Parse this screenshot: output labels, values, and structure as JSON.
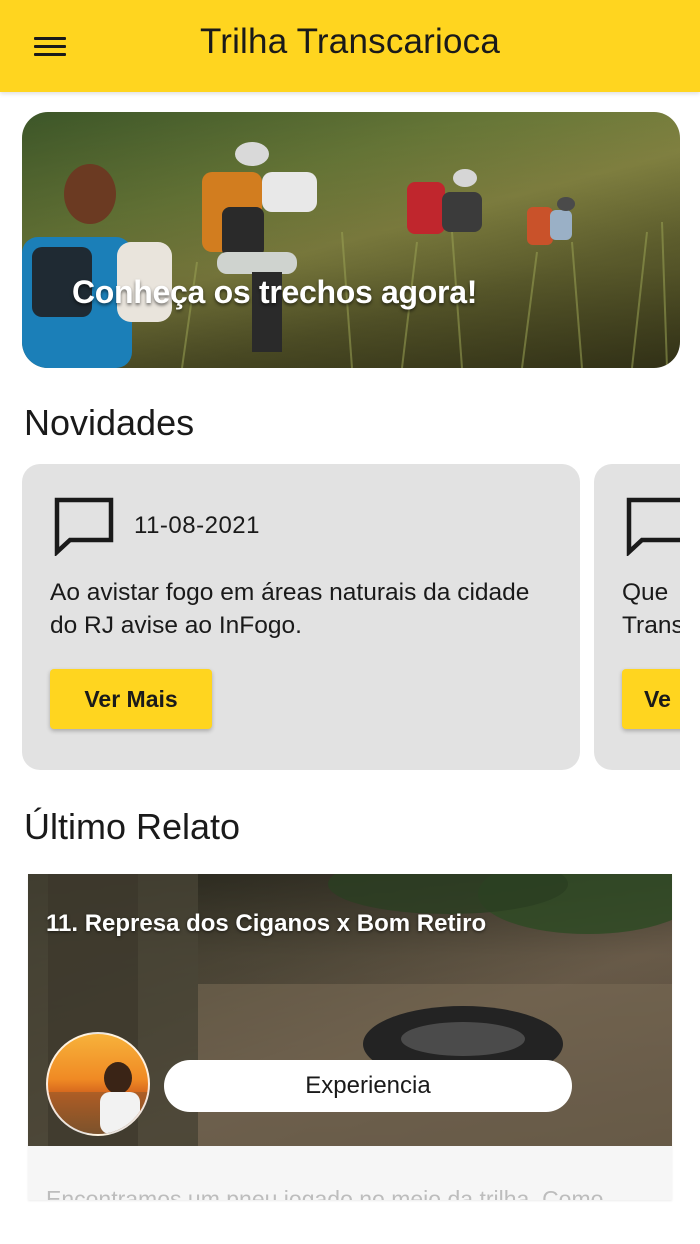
{
  "appbar": {
    "title": "Trilha Transcarioca",
    "menu_icon": "hamburger-menu-icon",
    "background_color": "#FFD51F"
  },
  "hero": {
    "caption": "Conheça os trechos agora!"
  },
  "news": {
    "section_title": "Novidades",
    "items": [
      {
        "icon": "chat-bubble-icon",
        "date": "11-08-2021",
        "text": "Ao avistar fogo em áreas naturais da cidade do RJ avise ao InFogo.",
        "button_label": "Ver Mais"
      },
      {
        "icon": "chat-bubble-icon",
        "date": "",
        "text_line1": "Que",
        "text_line2": "Trans",
        "button_label": "Ve"
      }
    ]
  },
  "last_report": {
    "section_title": "Último Relato",
    "caption": "11. Represa dos Ciganos x Bom Retiro",
    "badge_label": "Experiencia",
    "excerpt": "Encontramos um pneu jogado no meio da trilha. Como"
  }
}
